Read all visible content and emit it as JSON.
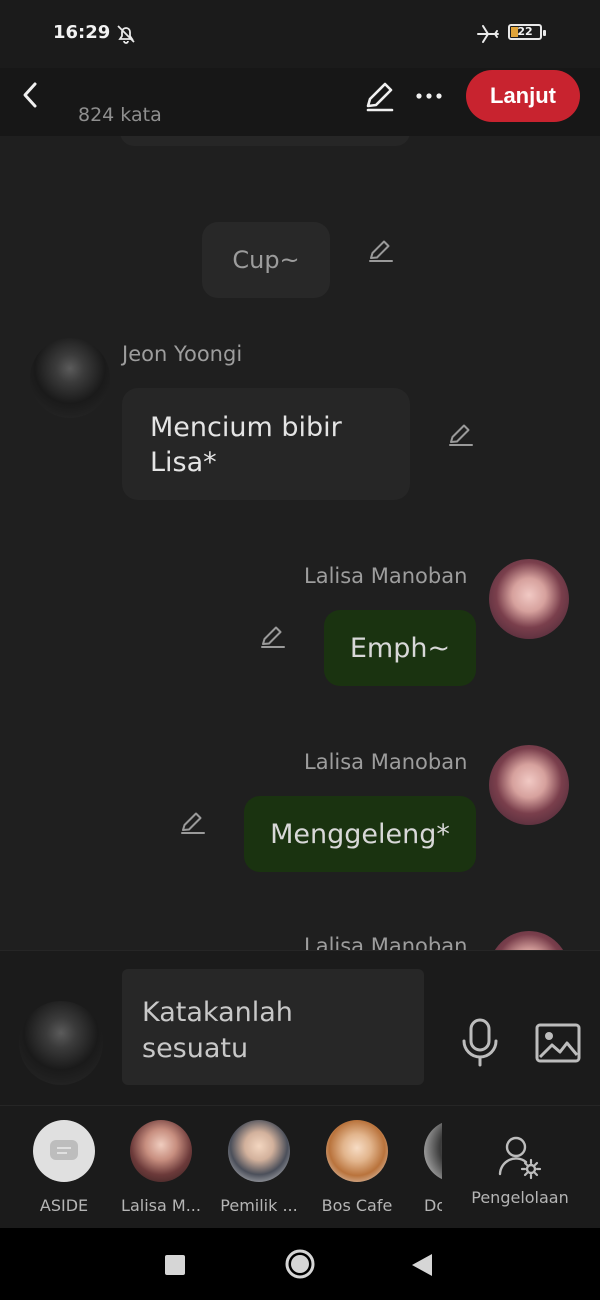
{
  "status_bar": {
    "time": "16:29",
    "battery": "22"
  },
  "header": {
    "word_count": "824 kata",
    "next_button": "Lanjut"
  },
  "messages": [
    {
      "type": "narration",
      "text": "Cup~"
    },
    {
      "type": "left",
      "sender": "Jeon Yoongi",
      "text": "Mencium bibir Lisa*"
    },
    {
      "type": "right",
      "sender": "Lalisa Manoban",
      "text": "Emph~"
    },
    {
      "type": "right",
      "sender": "Lalisa Manoban",
      "text": "Menggeleng*"
    },
    {
      "type": "right",
      "sender": "Lalisa Manoban",
      "text": ""
    }
  ],
  "input": {
    "placeholder": "Katakanlah sesuatu"
  },
  "characters": [
    {
      "label": "ASIDE"
    },
    {
      "label": "Lalisa M..."
    },
    {
      "label": "Pemilik ..."
    },
    {
      "label": "Bos Cafe"
    },
    {
      "label": "Dos"
    }
  ],
  "manage_label": "Pengelolaan",
  "colors": {
    "accent": "#c8232f",
    "my_bubble": "#1a3310",
    "other_bubble": "#262626"
  }
}
